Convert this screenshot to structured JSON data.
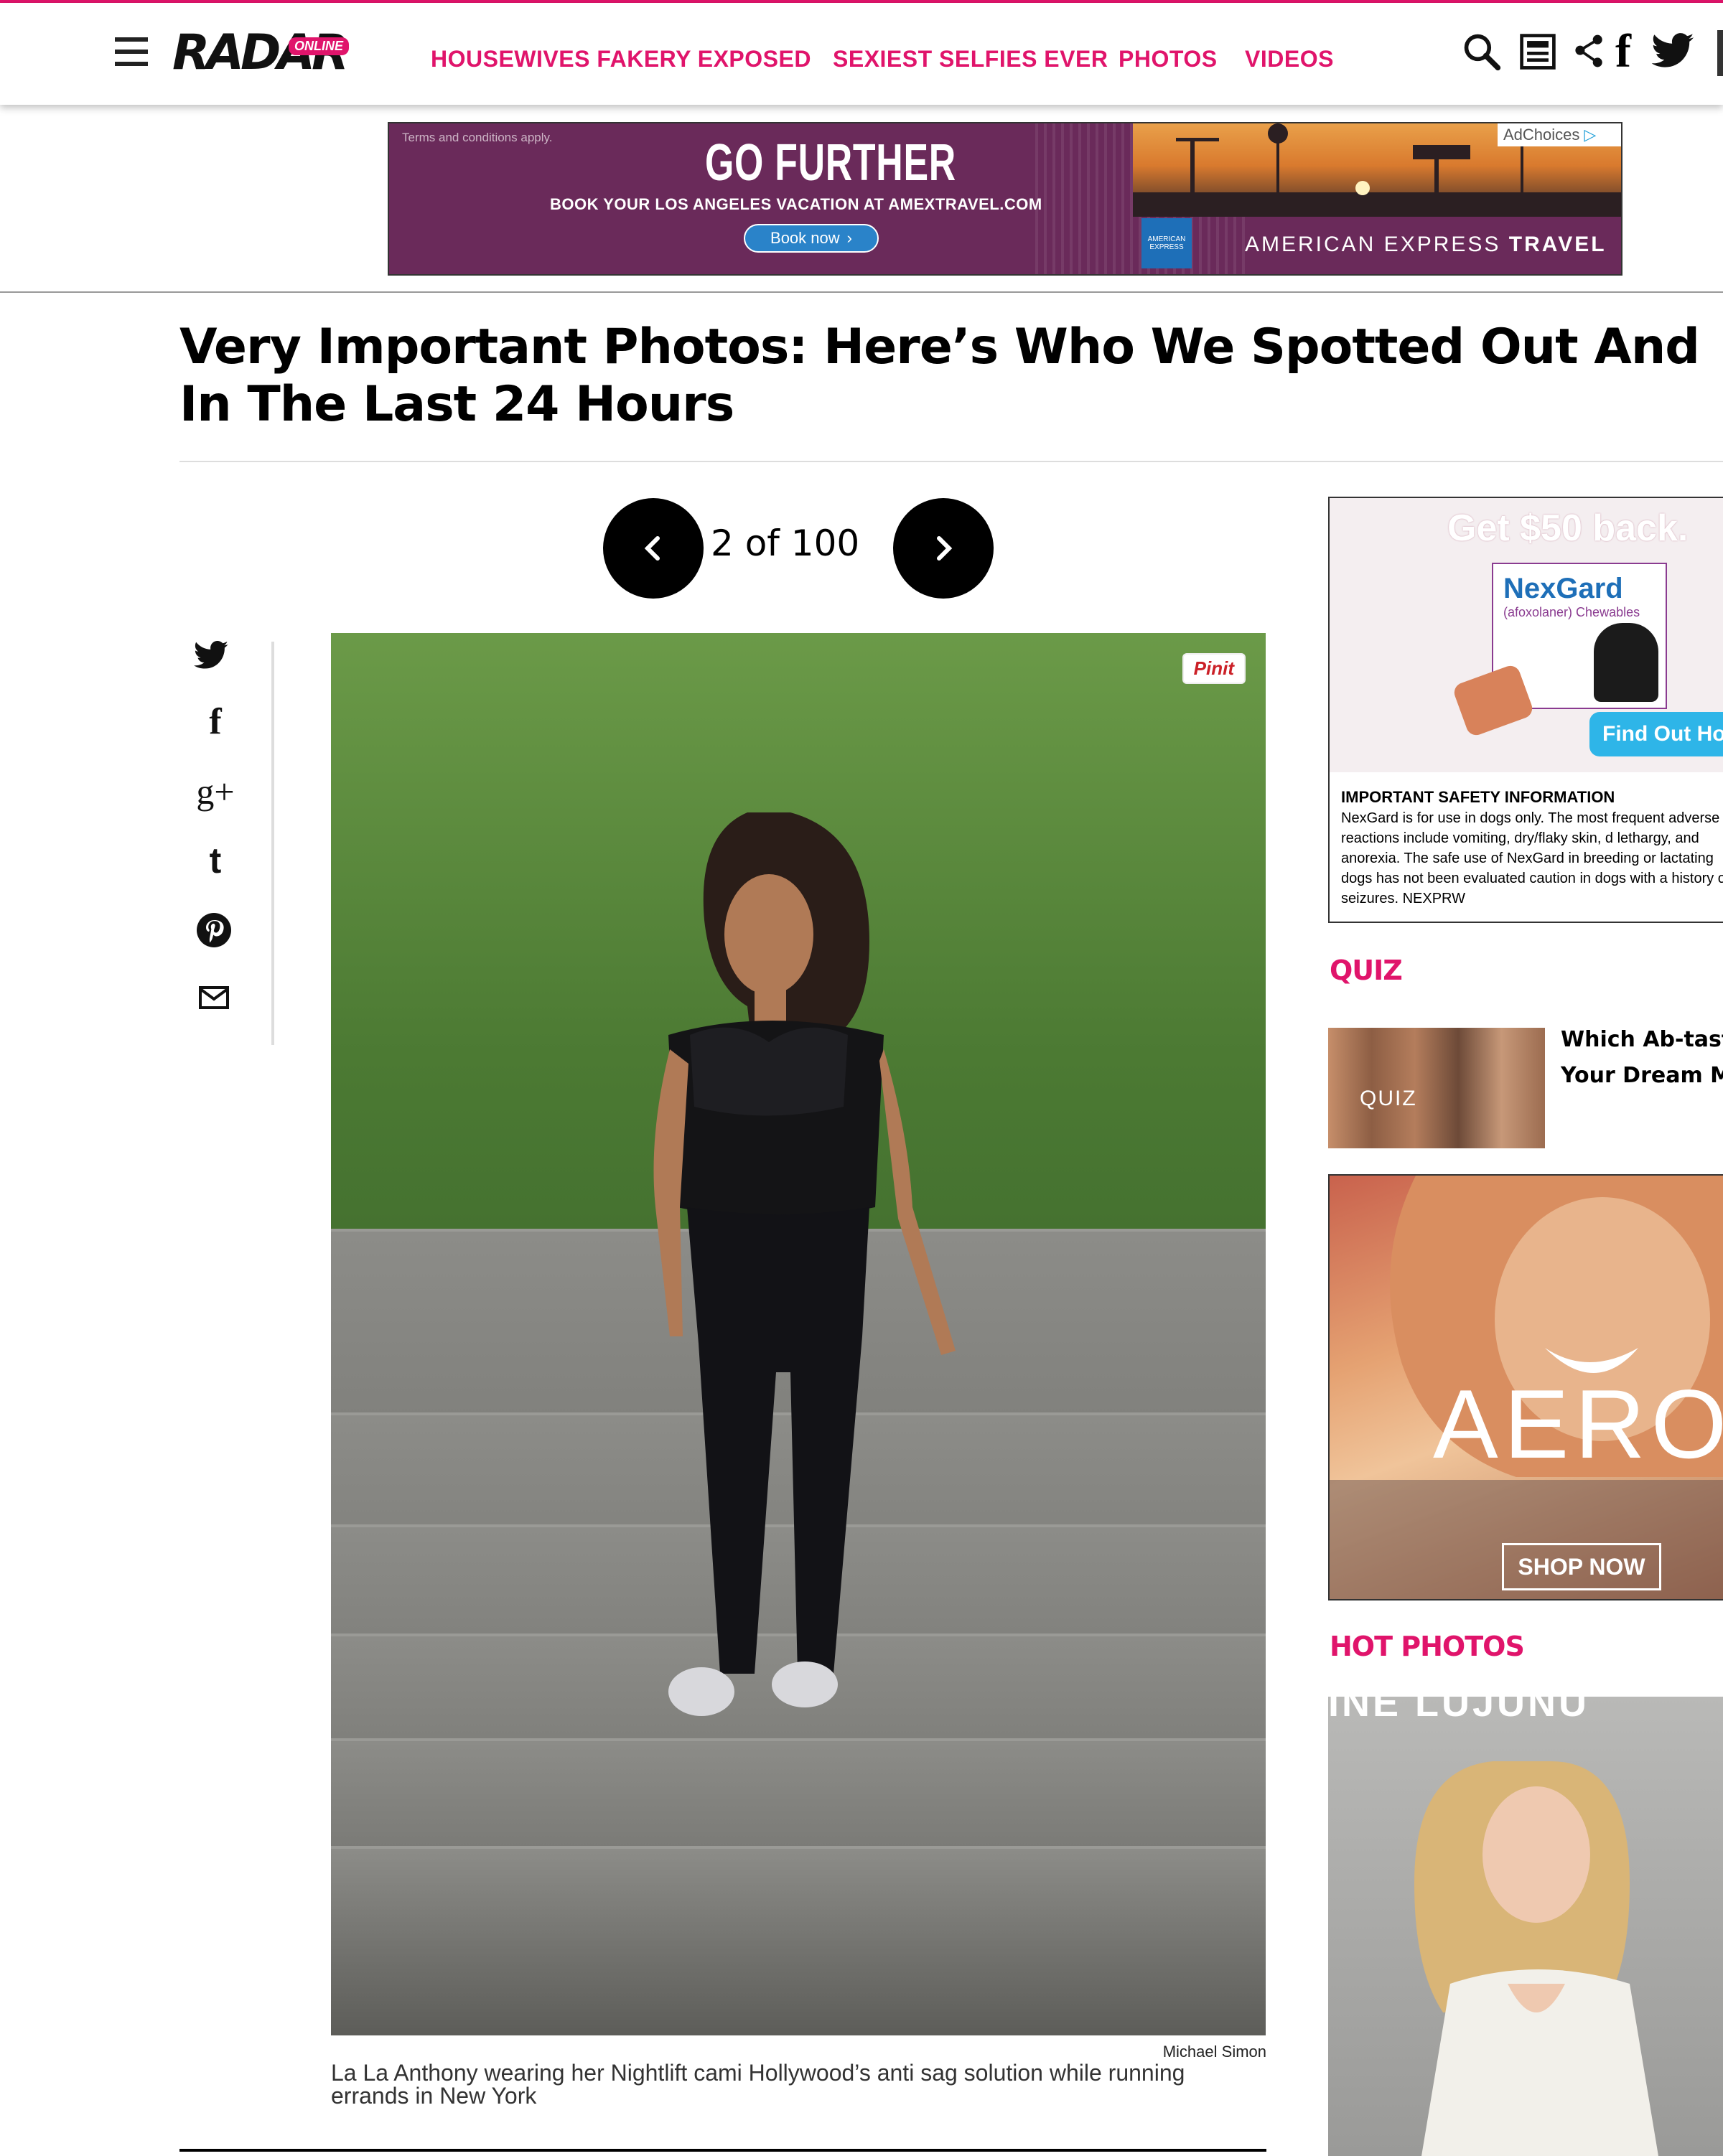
{
  "header": {
    "logo": "RADAR",
    "logo_badge": "ONLINE",
    "nav": [
      {
        "label": "HOUSEWIVES FAKERY EXPOSED"
      },
      {
        "label": "SEXIEST SELFIES EVER"
      },
      {
        "label": "PHOTOS"
      },
      {
        "label": "VIDEOS"
      }
    ],
    "icons": [
      "menu-icon",
      "search-icon",
      "newsletter-icon",
      "share-icon",
      "facebook-icon",
      "twitter-icon"
    ]
  },
  "top_ad": {
    "terms": "Terms and conditions apply.",
    "headline": "GO FURTHER",
    "subline": "BOOK YOUR LOS ANGELES VACATION AT AMEXTRAVEL.COM",
    "cta": "Book now",
    "adchoices": "AdChoices",
    "brand_logo": "AMERICAN EXPRESS",
    "brand_prefix": "AMERICAN EXPRESS",
    "brand_suffix": "TRAVEL"
  },
  "article": {
    "headline_line1": "Very Important Photos: Here’s Who We Spotted Out And Al",
    "headline_line2": "In The Last 24 Hours",
    "pager": "2 of 100",
    "pin_label": "Pinit",
    "photo_credit": "Michael Simon",
    "caption": "La La Anthony wearing her Nightlift cami Hollywood’s anti sag solution while running errands in New York"
  },
  "share": {
    "items": [
      {
        "icon": "twitter-icon",
        "glyph": "🐦"
      },
      {
        "icon": "facebook-icon",
        "glyph": "f"
      },
      {
        "icon": "google-plus-icon",
        "glyph": "g+"
      },
      {
        "icon": "tumblr-icon",
        "glyph": "t"
      },
      {
        "icon": "pinterest-icon",
        "glyph": "P"
      },
      {
        "icon": "email-icon",
        "glyph": "✉"
      }
    ]
  },
  "right_ad": {
    "headline": "Get $50 back.",
    "product": "NexGard",
    "product_sub": "(afoxolaner) Chewables",
    "cta": "Find Out Hov",
    "safety_title": "IMPORTANT SAFETY INFORMATION",
    "safety_text": "NexGard is for use in dogs only. The most frequent adverse reactions include vomiting, dry/flaky skin, d lethargy, and anorexia. The safe use of NexGard in breeding or lactating dogs has not been evaluated caution in dogs with a history of seizures. NEXPRW"
  },
  "quiz": {
    "heading": "QUIZ",
    "thumb_label": "QUIZ",
    "title_line1": "Which Ab-tastic",
    "title_line2": "Your Dream Ma"
  },
  "aero_ad": {
    "brand": "AERO",
    "cta": "SHOP NOW"
  },
  "hot_photos": {
    "heading": "HOT PHOTOS",
    "banner_text": "INE LUJUNU"
  },
  "colors": {
    "accent": "#e0146b",
    "ad_purple": "#6a2a5a",
    "amex_blue": "#1e6fb8"
  }
}
